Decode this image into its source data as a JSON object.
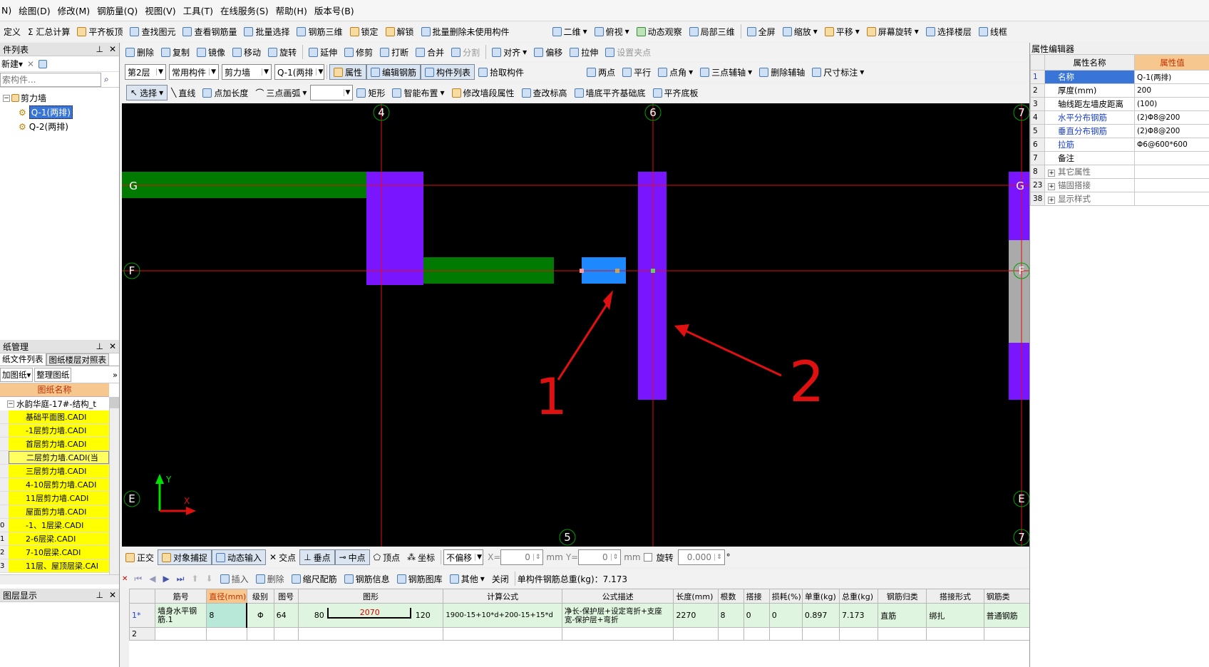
{
  "menu": {
    "items": [
      "N)",
      "绘图(D)",
      "修改(M)",
      "钢筋量(Q)",
      "视图(V)",
      "工具(T)",
      "在线服务(S)",
      "帮助(H)",
      "版本号(B)"
    ]
  },
  "toolbar1": {
    "items": [
      "定义",
      "Σ 汇总计算",
      "平齐板顶",
      "查找图元",
      "查看钢筋量",
      "批量选择",
      "钢筋三维",
      "锁定",
      "解锁",
      "批量删除未使用构件"
    ],
    "right_items": [
      "二维",
      "俯视",
      "动态观察",
      "局部三维",
      "全屏",
      "缩放",
      "平移",
      "屏幕旋转",
      "选择楼层",
      "线框"
    ]
  },
  "toolbar2": {
    "items": [
      "删除",
      "复制",
      "镜像",
      "移动",
      "旋转",
      "延伸",
      "修剪",
      "打断",
      "合并",
      "分割",
      "对齐",
      "偏移",
      "拉伸",
      "设置夹点"
    ]
  },
  "toolbar3": {
    "floor": "第2层",
    "category": "常用构件",
    "type": "剪力墙",
    "component": "Q-1(两排",
    "items": [
      "属性",
      "编辑钢筋",
      "构件列表",
      "拾取构件"
    ],
    "right_items": [
      "两点",
      "平行",
      "点角",
      "三点辅轴",
      "删除辅轴",
      "尺寸标注"
    ]
  },
  "toolbar4": {
    "select": "选择",
    "items": [
      "直线",
      "点加长度",
      "三点画弧"
    ],
    "right_items": [
      "矩形",
      "智能布置",
      "修改墙段属性",
      "查改标高",
      "墙底平齐基础底",
      "平齐底板"
    ]
  },
  "component_list": {
    "title": "件列表",
    "new_btn": "新建",
    "search_placeholder": "索构件...",
    "tree_root": "剪力墙",
    "tree_items": [
      "Q-1(两排)",
      "Q-2(两排)"
    ]
  },
  "drawing_mgmt": {
    "title": "纸管理",
    "tabs": [
      "纸文件列表",
      "图纸楼层对照表"
    ],
    "buttons": [
      "加图纸",
      "整理图纸"
    ],
    "col_header": "图纸名称",
    "group": "水韵华庭-17#-结构_t",
    "rows": [
      "基础平面图.CADI",
      "-1层剪力墙.CADI",
      "首层剪力墙.CADI",
      "二层剪力墙.CADI(当",
      "三层剪力墙.CADI",
      "4-10层剪力墙.CADI",
      "11层剪力墙.CADI",
      "屋面剪力墙.CADI",
      "-1、1层梁.CADI",
      "2-6层梁.CADI",
      "7-10层梁.CADI",
      "11层、屋顶层梁.CAI"
    ],
    "row_numbers": [
      "",
      "",
      "",
      "",
      "",
      "",
      "",
      "",
      "0",
      "1",
      "2",
      "3"
    ]
  },
  "layer_display": {
    "title": "图层显示"
  },
  "canvas": {
    "axis_labels": {
      "col4": "4",
      "col5": "5",
      "col6": "6",
      "col7": "7",
      "rowG": "G",
      "rowF": "F",
      "rowE": "E"
    },
    "coord_x": "X",
    "coord_y": "Y",
    "annotation1": "1",
    "annotation2": "2"
  },
  "statusbar": {
    "items": [
      "正交",
      "对象捕捉",
      "动态输入",
      "交点",
      "垂点",
      "中点",
      "顶点",
      "坐标"
    ],
    "offset_mode": "不偏移",
    "x_label": "X=",
    "x_value": "0",
    "unit1": "mm",
    "y_label": "Y=",
    "y_value": "0",
    "unit2": "mm",
    "rotate_label": "旋转",
    "rotate_value": "0.000",
    "deg": "°"
  },
  "steel_toolbar": {
    "items": [
      "插入",
      "删除",
      "缩尺配筋",
      "钢筋信息",
      "钢筋图库",
      "其他",
      "关闭"
    ],
    "total": "单构件钢筋总重(kg)：7.173"
  },
  "steel_table": {
    "headers": [
      "",
      "筋号",
      "直径(mm)",
      "级别",
      "图号",
      "图形",
      "计算公式",
      "公式描述",
      "长度(mm)",
      "根数",
      "搭接",
      "损耗(%)",
      "单重(kg)",
      "总重(kg)",
      "钢筋归类",
      "搭接形式",
      "钢筋类"
    ],
    "row1": {
      "no": "1*",
      "name": "墙身水平钢筋.1",
      "dia": "8",
      "grade": "Φ",
      "fig": "64",
      "left": "80",
      "mid": "2070",
      "right": "120",
      "formula": "1900-15+10*d+200-15+15*d",
      "desc": "净长-保护层+设定弯折+支座宽-保护层+弯折",
      "length": "2270",
      "count": "8",
      "lap": "0",
      "loss": "0",
      "unit_w": "0.897",
      "total_w": "7.173",
      "cat": "直筋",
      "lap_type": "绑扎",
      "type": "普通钢筋"
    },
    "row2_no": "2"
  },
  "property_editor": {
    "title": "属性编辑器",
    "col_name": "属性名称",
    "col_value": "属性值",
    "rows": [
      {
        "n": "1",
        "name": "名称",
        "value": "Q-1(两排)"
      },
      {
        "n": "2",
        "name": "厚度(mm)",
        "value": "200"
      },
      {
        "n": "3",
        "name": "轴线距左墙皮距离",
        "value": "(100)"
      },
      {
        "n": "4",
        "name": "水平分布钢筋",
        "value": "(2)Φ8@200"
      },
      {
        "n": "5",
        "name": "垂直分布钢筋",
        "value": "(2)Φ8@200"
      },
      {
        "n": "6",
        "name": "拉筋",
        "value": "Φ6@600*600"
      },
      {
        "n": "7",
        "name": "备注",
        "value": ""
      },
      {
        "n": "8",
        "name": "其它属性",
        "value": ""
      },
      {
        "n": "23",
        "name": "锚固搭接",
        "value": ""
      },
      {
        "n": "38",
        "name": "显示样式",
        "value": ""
      }
    ]
  }
}
